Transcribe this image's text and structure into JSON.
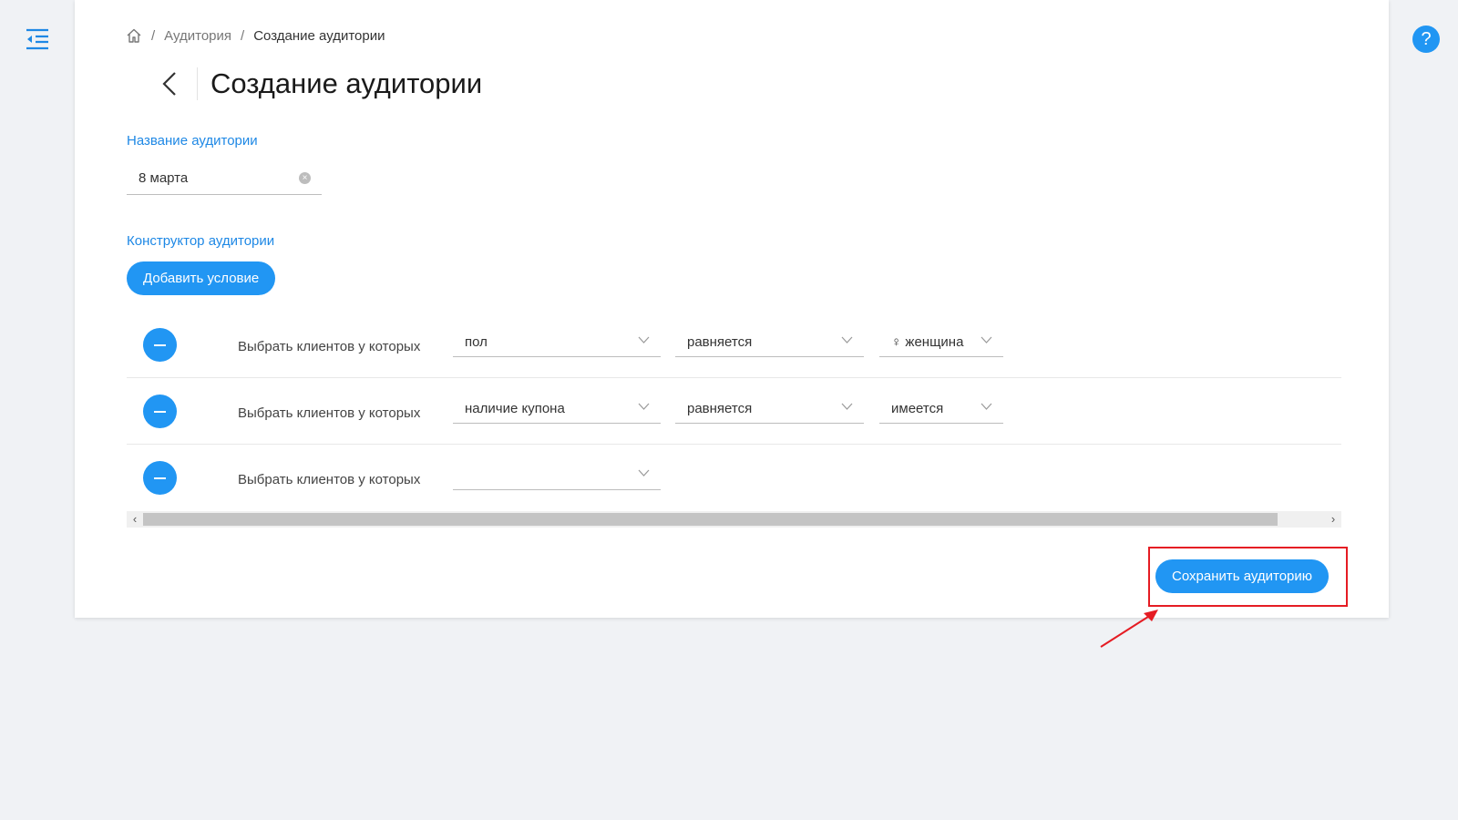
{
  "breadcrumb": {
    "items": [
      "Аудитория",
      "Создание аудитории"
    ],
    "separator": "/"
  },
  "page": {
    "title": "Создание аудитории"
  },
  "name_section": {
    "label": "Название аудитории",
    "value": "8 марта"
  },
  "builder_section": {
    "label": "Конструктор аудитории",
    "add_button": "Добавить условие"
  },
  "conditions": [
    {
      "label": "Выбрать клиентов у которых",
      "field": "пол",
      "operator": "равняется",
      "value": "♀ женщина"
    },
    {
      "label": "Выбрать клиентов у которых",
      "field": "наличие купона",
      "operator": "равняется",
      "value": "имеется"
    },
    {
      "label": "Выбрать клиентов у которых",
      "field": ""
    }
  ],
  "scrollbar": {
    "left_arrow": "‹",
    "right_arrow": "›"
  },
  "help_label": "?",
  "actions": {
    "save_button": "Сохранить аудиторию"
  },
  "colors": {
    "accent": "#2196f3",
    "label_blue": "#1e88e5",
    "highlight": "#e51c23",
    "background": "#f0f2f5"
  },
  "icons": {
    "menu": "menu-collapse-icon",
    "help": "help-icon",
    "home": "home-icon",
    "back": "back-arrow-icon",
    "clear": "clear-icon",
    "chevron": "chevron-down-icon",
    "remove": "minus-icon"
  }
}
